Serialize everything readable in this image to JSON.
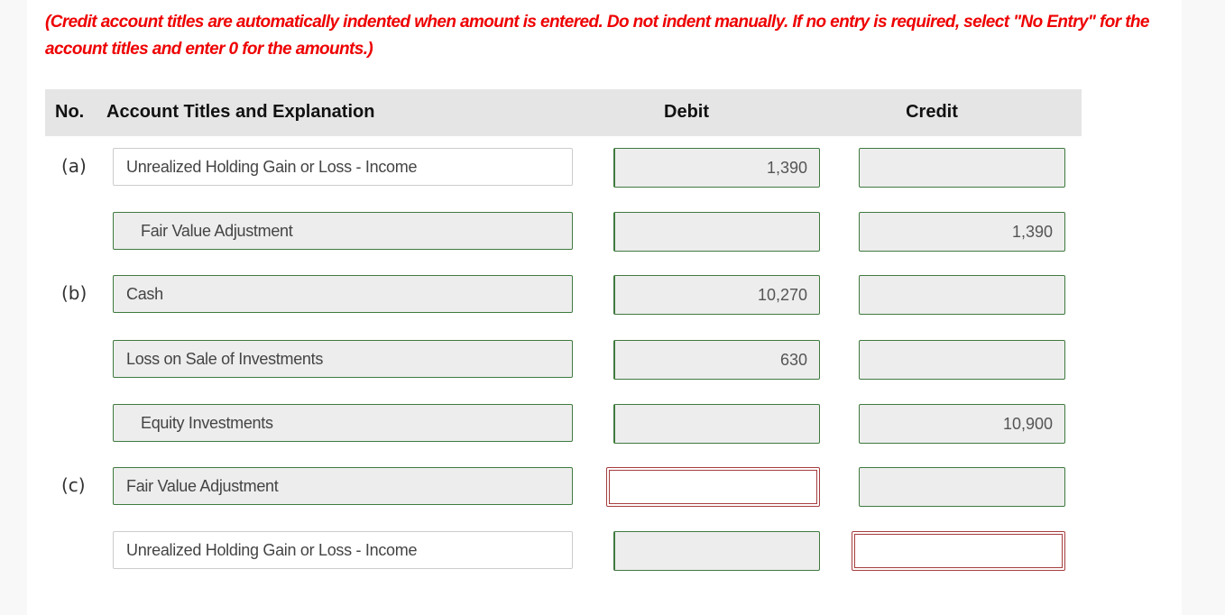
{
  "instructions": "(Credit account titles are automatically indented when amount is entered. Do not indent manually. If no entry is required, select \"No Entry\" for the account titles and enter 0 for the amounts.)",
  "table": {
    "headers": {
      "no": "No.",
      "account": "Account Titles and Explanation",
      "debit": "Debit",
      "credit": "Credit"
    },
    "rows": [
      {
        "no": "(a)",
        "account": "Unrealized Holding Gain or Loss - Income",
        "debit": "1,390",
        "credit": "",
        "indented": false,
        "account_state": "plain",
        "debit_state": "ok",
        "credit_state": "ok"
      },
      {
        "no": "",
        "account": "Fair Value Adjustment",
        "debit": "",
        "credit": "1,390",
        "indented": true,
        "account_state": "ok",
        "debit_state": "ok",
        "credit_state": "ok"
      },
      {
        "no": "(b)",
        "account": "Cash",
        "debit": "10,270",
        "credit": "",
        "indented": false,
        "account_state": "ok",
        "debit_state": "ok",
        "credit_state": "ok"
      },
      {
        "no": "",
        "account": "Loss on Sale of Investments",
        "debit": "630",
        "credit": "",
        "indented": false,
        "account_state": "ok",
        "debit_state": "ok",
        "credit_state": "ok"
      },
      {
        "no": "",
        "account": "Equity Investments",
        "debit": "",
        "credit": "10,900",
        "indented": true,
        "account_state": "ok",
        "debit_state": "ok",
        "credit_state": "ok"
      },
      {
        "no": "(c)",
        "account": "Fair Value Adjustment",
        "debit": "",
        "credit": "",
        "indented": false,
        "account_state": "ok",
        "debit_state": "error",
        "credit_state": "ok"
      },
      {
        "no": "",
        "account": "Unrealized Holding Gain or Loss - Income",
        "debit": "",
        "credit": "",
        "indented": false,
        "account_state": "plain",
        "debit_state": "ok",
        "credit_state": "error"
      }
    ]
  },
  "colors": {
    "instruction_text": "#ee0000",
    "correct_border": "#3f7a3f",
    "error_border": "#a63d3d",
    "header_bg": "#e5e5e5",
    "field_bg": "#ededed"
  }
}
